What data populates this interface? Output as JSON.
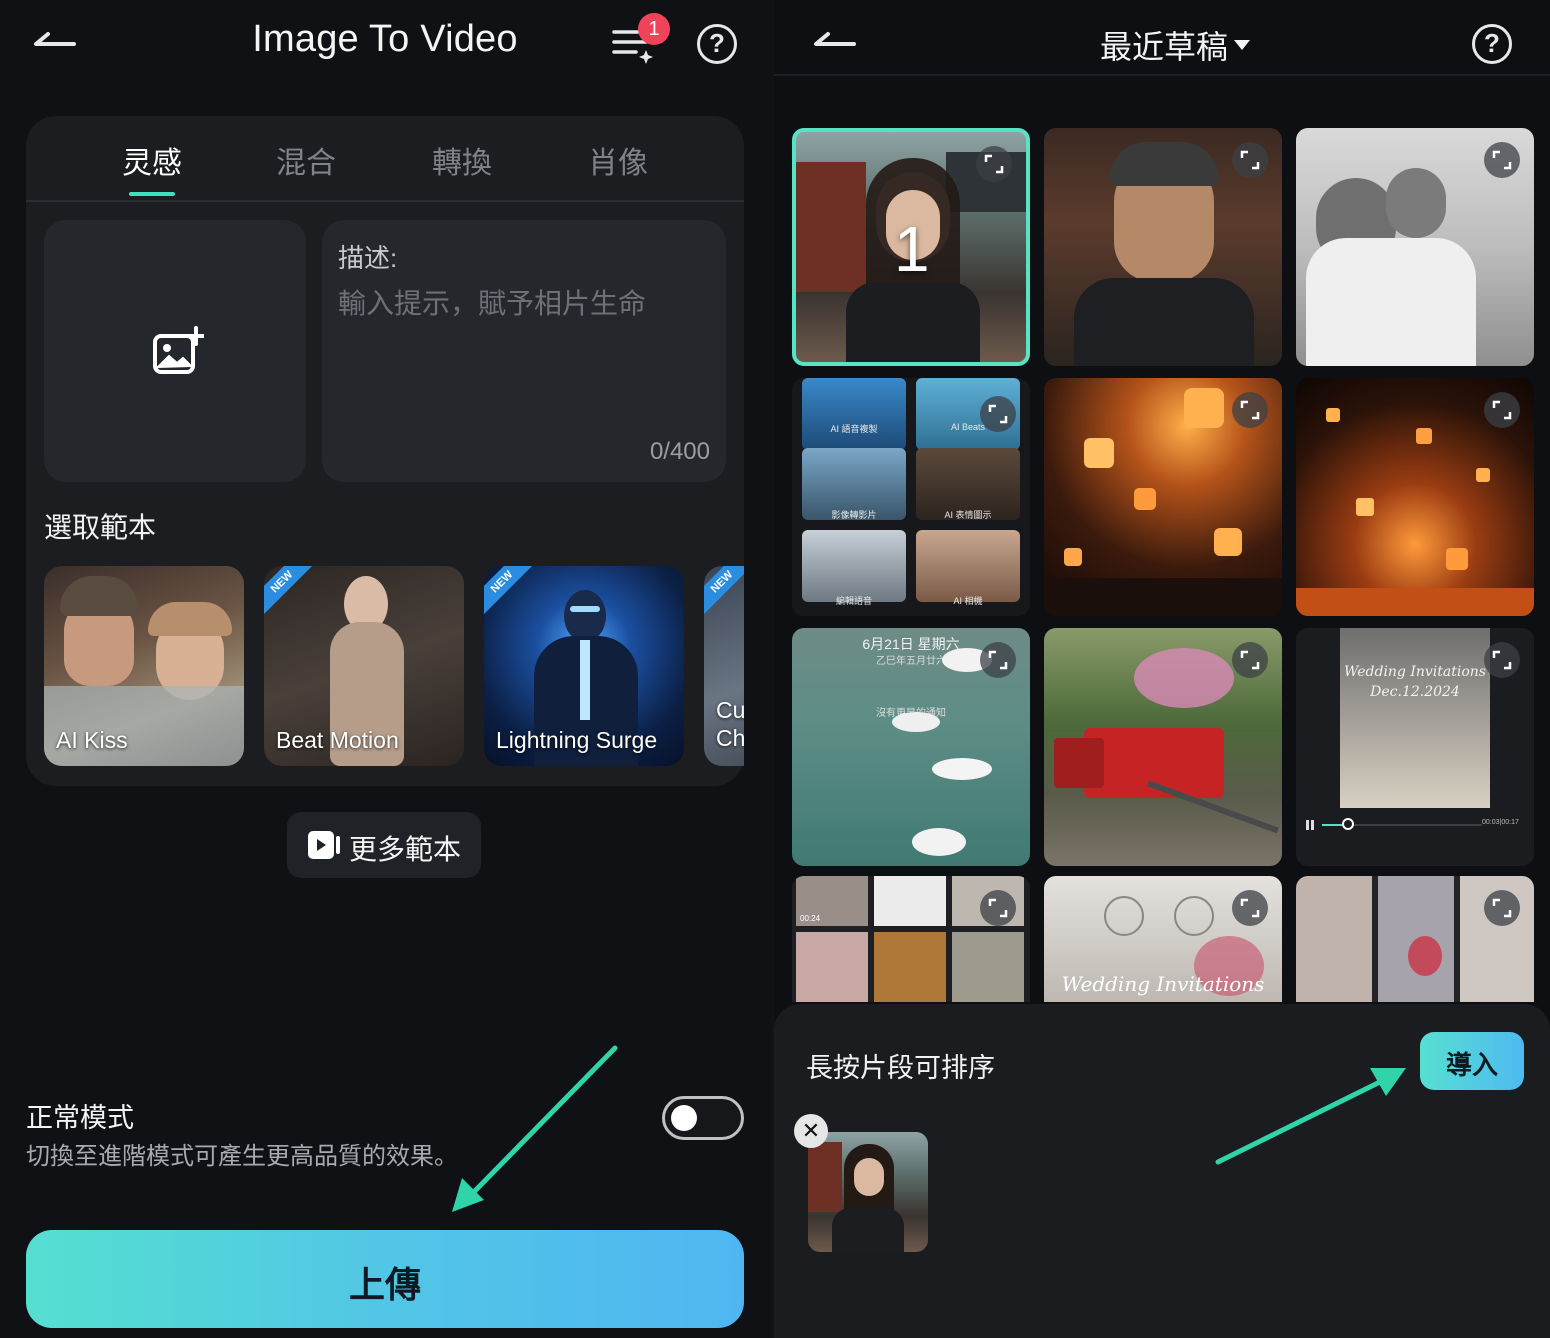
{
  "left": {
    "title": "Image To Video",
    "badge_count": "1",
    "help_symbol": "?",
    "tabs": [
      {
        "label": "灵感"
      },
      {
        "label": "混合"
      },
      {
        "label": "轉換"
      },
      {
        "label": "肖像"
      }
    ],
    "description": {
      "label": "描述:",
      "placeholder": "輸入提示，賦予相片生命",
      "counter": "0/400"
    },
    "templates_title": "選取範本",
    "templates": [
      {
        "label": "AI Kiss",
        "new": false
      },
      {
        "label": "Beat Motion",
        "new": true
      },
      {
        "label": "Lightning Surge",
        "new": true
      },
      {
        "label": "Cu Ch",
        "new": true
      }
    ],
    "new_badge": "NEW",
    "more_templates_label": "更多範本",
    "mode": {
      "title": "正常模式",
      "subtitle": "切換至進階模式可產生更高品質的效果。",
      "toggle_on": false
    },
    "upload_button": "上傳"
  },
  "right": {
    "title": "最近草稿",
    "help_symbol": "?",
    "selected_number": "1",
    "mini_labels": [
      "AI 語音複製",
      "AI Beats",
      "影像轉影片",
      "AI 表情圖示",
      "編輯語音",
      "AI 相機"
    ],
    "overlay_date": "6月21日 星期六",
    "overlay_lunar": "乙巳年五月廿六",
    "overlay_notice": "沒有更早的通知",
    "wedding_text": "Wedding Invitations",
    "wedding_date": "Dec.12.2024",
    "video_time": "00:03|00:17",
    "collage_time": "00:24",
    "sheet_hint": "長按片段可排序",
    "import_button": "導入",
    "remove_symbol": "✕"
  },
  "colors": {
    "accent": "#57e4c4",
    "badge": "#f0435a",
    "button_gradient_start": "#55dfd0",
    "button_gradient_end": "#4fb6f2",
    "new_badge": "#2a8de0"
  },
  "icons": [
    "back-arrow-icon",
    "task-list-icon",
    "help-icon",
    "add-image-icon",
    "play-template-icon",
    "expand-icon",
    "close-icon",
    "dropdown-caret-icon"
  ]
}
